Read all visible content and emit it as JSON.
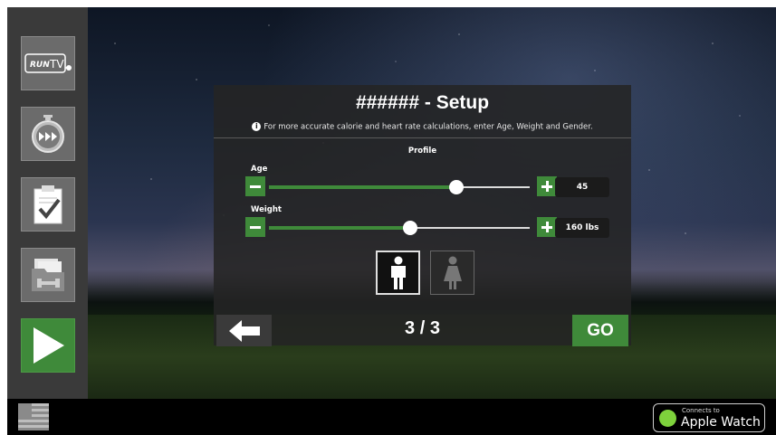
{
  "setup": {
    "title": "###### - Setup",
    "hint": "For more accurate calorie and heart rate calculations, enter Age, Weight and Gender.",
    "profile_label": "Profile",
    "age": {
      "label": "Age",
      "value": "45",
      "level": 0.72
    },
    "weight": {
      "label": "Weight",
      "value": "160 lbs",
      "level": 0.54
    },
    "gender": {
      "selected": "male",
      "options": [
        "male-icon",
        "female-icon"
      ]
    },
    "step_count": "3 / 3",
    "go_label": "GO"
  },
  "sidebar": {
    "items": [
      {
        "icon": "run-tv-logo-icon",
        "logo_text": "RUN TV"
      },
      {
        "icon": "stopwatch-icon"
      },
      {
        "icon": "clipboard-check-icon"
      },
      {
        "icon": "folder-weight-icon"
      },
      {
        "icon": "play-icon"
      }
    ]
  },
  "footer": {
    "flag_icon": "us-flag-icon",
    "watch_badge": {
      "small": "Connects to",
      "big": "Apple Watch"
    }
  },
  "colors": {
    "accent": "#3f8a3a",
    "panel": "#242424",
    "sidebar": "#3a3a3a"
  }
}
